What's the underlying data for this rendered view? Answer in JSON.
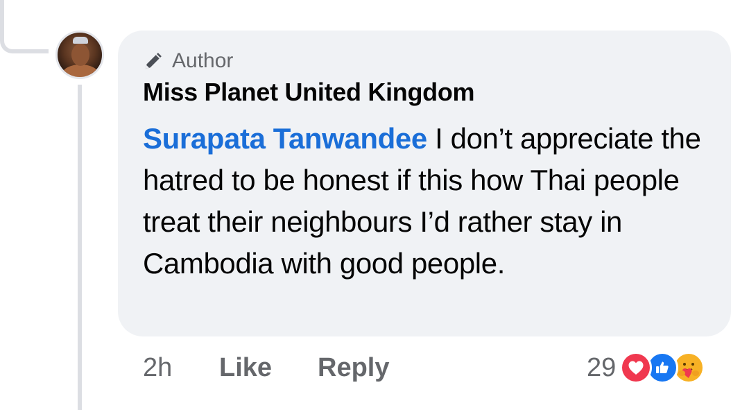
{
  "comment": {
    "badge_label": "Author",
    "author_name": "Miss Planet United Kingdom",
    "mention": "Surapata Tanwandee",
    "text": " I don’t appreciate the hatred to be honest if this how Thai people treat their neighbours I’d rather stay in Cambodia with good people.",
    "timestamp": "2h",
    "like_label": "Like",
    "reply_label": "Reply",
    "reaction_count": "29",
    "reactions": [
      "love-icon",
      "like-icon",
      "care-icon"
    ]
  },
  "colors": {
    "mention": "#1a6ed8",
    "bubble": "#f0f2f5",
    "meta_text": "#65676b",
    "love": "#f0384f",
    "like": "#1877f2",
    "care": "#f7b125"
  }
}
